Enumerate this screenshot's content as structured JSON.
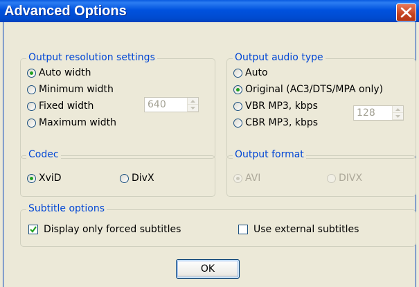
{
  "window": {
    "title": "Advanced Options"
  },
  "resolution": {
    "legend": "Output resolution settings",
    "options": [
      "Auto width",
      "Minimum width",
      "Fixed width",
      "Maximum width"
    ],
    "selected": "Auto width",
    "fixed_width_value": "640"
  },
  "audio": {
    "legend": "Output audio type",
    "options": [
      "Auto",
      "Original (AC3/DTS/MPA only)",
      "VBR MP3, kbps",
      "CBR MP3, kbps"
    ],
    "selected": "Original (AC3/DTS/MPA only)",
    "bitrate_value": "128"
  },
  "codec": {
    "legend": "Codec",
    "options": [
      "XviD",
      "DivX"
    ],
    "selected": "XviD"
  },
  "format": {
    "legend": "Output format",
    "options": [
      "AVI",
      "DIVX"
    ],
    "selected": "AVI",
    "disabled": true
  },
  "subtitles": {
    "legend": "Subtitle options",
    "forced_label": "Display only forced subtitles",
    "forced_checked": true,
    "external_label": "Use external subtitles",
    "external_checked": false
  },
  "buttons": {
    "ok_label": "OK"
  },
  "colors": {
    "titlebar": "#0052de",
    "legend_text": "#0046d5",
    "radio_dot": "#21a121",
    "disabled_text": "#aca899"
  }
}
